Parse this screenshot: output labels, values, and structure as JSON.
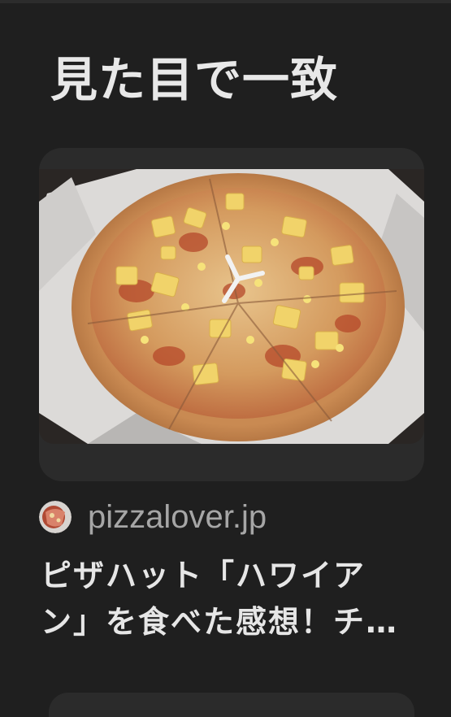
{
  "section": {
    "title": "見た目で一致"
  },
  "result": {
    "image_icon": "pizza-photo",
    "favicon_icon": "site-favicon",
    "source": "pizzalover.jp",
    "title_line1": "ピザハット「ハワイア",
    "title_line2": "ン」を食べた感想！チ…"
  },
  "colors": {
    "background": "#1f1f1f",
    "card": "#2b2b2b",
    "title": "#e8e8e8",
    "source": "#a6a6a6"
  }
}
